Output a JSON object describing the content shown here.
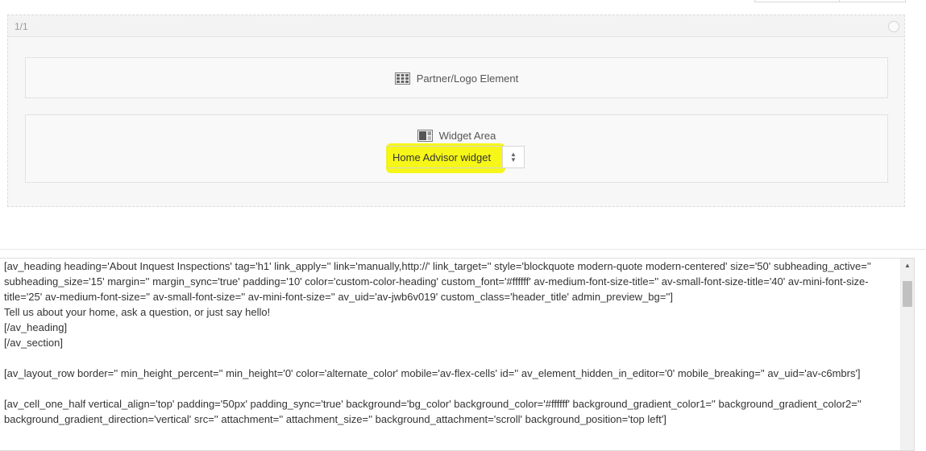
{
  "column": {
    "size_label": "1/1"
  },
  "elements": {
    "partner_title": "Partner/Logo Element",
    "widget_title": "Widget Area",
    "widget_select_value": "Home Advisor widget"
  },
  "colors": {
    "highlight": "#f6f718"
  },
  "icons": {
    "partner": "grid-icon",
    "widget": "widget-area-icon",
    "select": "updown-arrows-icon",
    "column": "circle-icon",
    "scroll": "arrow-up-icon"
  },
  "shortcode_lines": [
    "[av_heading heading='About Inquest Inspections' tag='h1' link_apply='' link='manually,http://' link_target='' style='blockquote modern-quote modern-centered' size='50' subheading_active='' subheading_size='15' margin='' margin_sync='true' padding='10' color='custom-color-heading' custom_font='#ffffff' av-medium-font-size-title='' av-small-font-size-title='40' av-mini-font-size-title='25' av-medium-font-size='' av-small-font-size='' av-mini-font-size='' av_uid='av-jwb6v019' custom_class='header_title' admin_preview_bg='']",
    "Tell us about your home, ask a question, or just say hello!",
    "[/av_heading]",
    "[/av_section]",
    "",
    "[av_layout_row border='' min_height_percent='' min_height='0' color='alternate_color' mobile='av-flex-cells' id='' av_element_hidden_in_editor='0' mobile_breaking='' av_uid='av-c6mbrs']",
    "",
    "[av_cell_one_half vertical_align='top' padding='50px' padding_sync='true' background='bg_color' background_color='#ffffff' background_gradient_color1='' background_gradient_color2='' background_gradient_direction='vertical' src='' attachment='' attachment_size='' background_attachment='scroll' background_position='top left']"
  ]
}
